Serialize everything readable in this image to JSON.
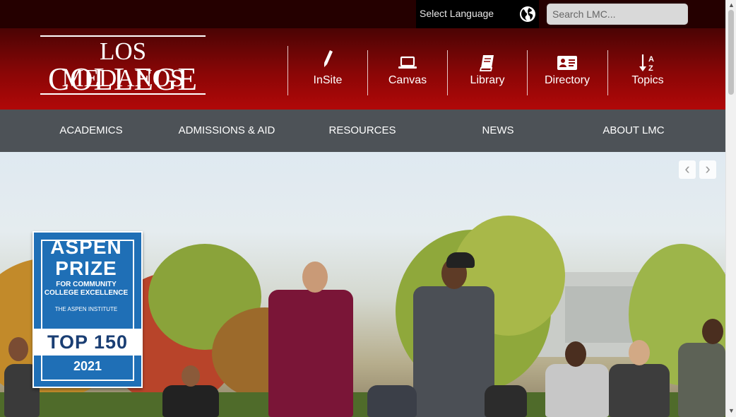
{
  "topbar": {
    "language_label": "Select Language",
    "language_icon": "globe-icon",
    "search_placeholder": "Search LMC..."
  },
  "logo": {
    "line1": "LOS MEDANOS",
    "line2": "COLLEGE"
  },
  "quick_links": [
    {
      "label": "InSite",
      "icon": "pen-icon"
    },
    {
      "label": "Canvas",
      "icon": "laptop-icon"
    },
    {
      "label": "Library",
      "icon": "book-icon"
    },
    {
      "label": "Directory",
      "icon": "id-card-icon"
    },
    {
      "label": "Topics",
      "icon": "sort-alpha-icon"
    }
  ],
  "main_nav": [
    {
      "label": "ACADEMICS"
    },
    {
      "label": "ADMISSIONS & AID"
    },
    {
      "label": "RESOURCES"
    },
    {
      "label": "NEWS"
    },
    {
      "label": "ABOUT LMC"
    }
  ],
  "hero": {
    "badge": {
      "line1": "ASPEN",
      "line2": "PRIZE",
      "line3": "FOR COMMUNITY",
      "line4": "COLLEGE EXCELLENCE",
      "line5": "THE ASPEN INSTITUTE",
      "line6": "TOP 150",
      "line7": "2021"
    },
    "carousel_prev_icon": "chevron-left-icon",
    "carousel_next_icon": "chevron-right-icon"
  },
  "colors": {
    "brand_red": "#a80707",
    "dark_red": "#250000",
    "nav_gray": "#4d5257",
    "aspen_blue": "#1f6fb6"
  }
}
